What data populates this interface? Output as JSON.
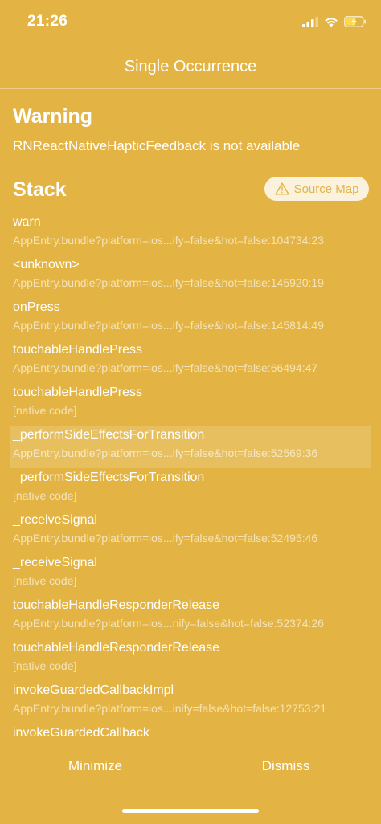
{
  "status_bar": {
    "time": "21:26",
    "icons": [
      "signal-icon",
      "wifi-icon",
      "battery-charging-icon"
    ]
  },
  "nav": {
    "title": "Single Occurrence"
  },
  "warning": {
    "title": "Warning",
    "message": "RNReactNativeHapticFeedback is not available"
  },
  "stack": {
    "title": "Stack",
    "source_map_label": "Source Map",
    "frames": [
      {
        "name": "warn",
        "location": "AppEntry.bundle?platform=ios...ify=false&hot=false:104734:23"
      },
      {
        "name": "<unknown>",
        "location": "AppEntry.bundle?platform=ios...ify=false&hot=false:145920:19"
      },
      {
        "name": "onPress",
        "location": "AppEntry.bundle?platform=ios...ify=false&hot=false:145814:49"
      },
      {
        "name": "touchableHandlePress",
        "location": "AppEntry.bundle?platform=ios...ify=false&hot=false:66494:47"
      },
      {
        "name": "touchableHandlePress",
        "location": "[native code]"
      },
      {
        "name": "_performSideEffectsForTransition",
        "location": "AppEntry.bundle?platform=ios...ify=false&hot=false:52569:36"
      },
      {
        "name": "_performSideEffectsForTransition",
        "location": "[native code]"
      },
      {
        "name": "_receiveSignal",
        "location": "AppEntry.bundle?platform=ios...ify=false&hot=false:52495:46"
      },
      {
        "name": "_receiveSignal",
        "location": "[native code]"
      },
      {
        "name": "touchableHandleResponderRelease",
        "location": "AppEntry.bundle?platform=ios...nify=false&hot=false:52374:26"
      },
      {
        "name": "touchableHandleResponderRelease",
        "location": "[native code]"
      },
      {
        "name": "invokeGuardedCallbackImpl",
        "location": "AppEntry.bundle?platform=ios...inify=false&hot=false:12753:21"
      },
      {
        "name": "invokeGuardedCallback",
        "location": ""
      }
    ]
  },
  "bottom": {
    "minimize_label": "Minimize",
    "dismiss_label": "Dismiss"
  }
}
